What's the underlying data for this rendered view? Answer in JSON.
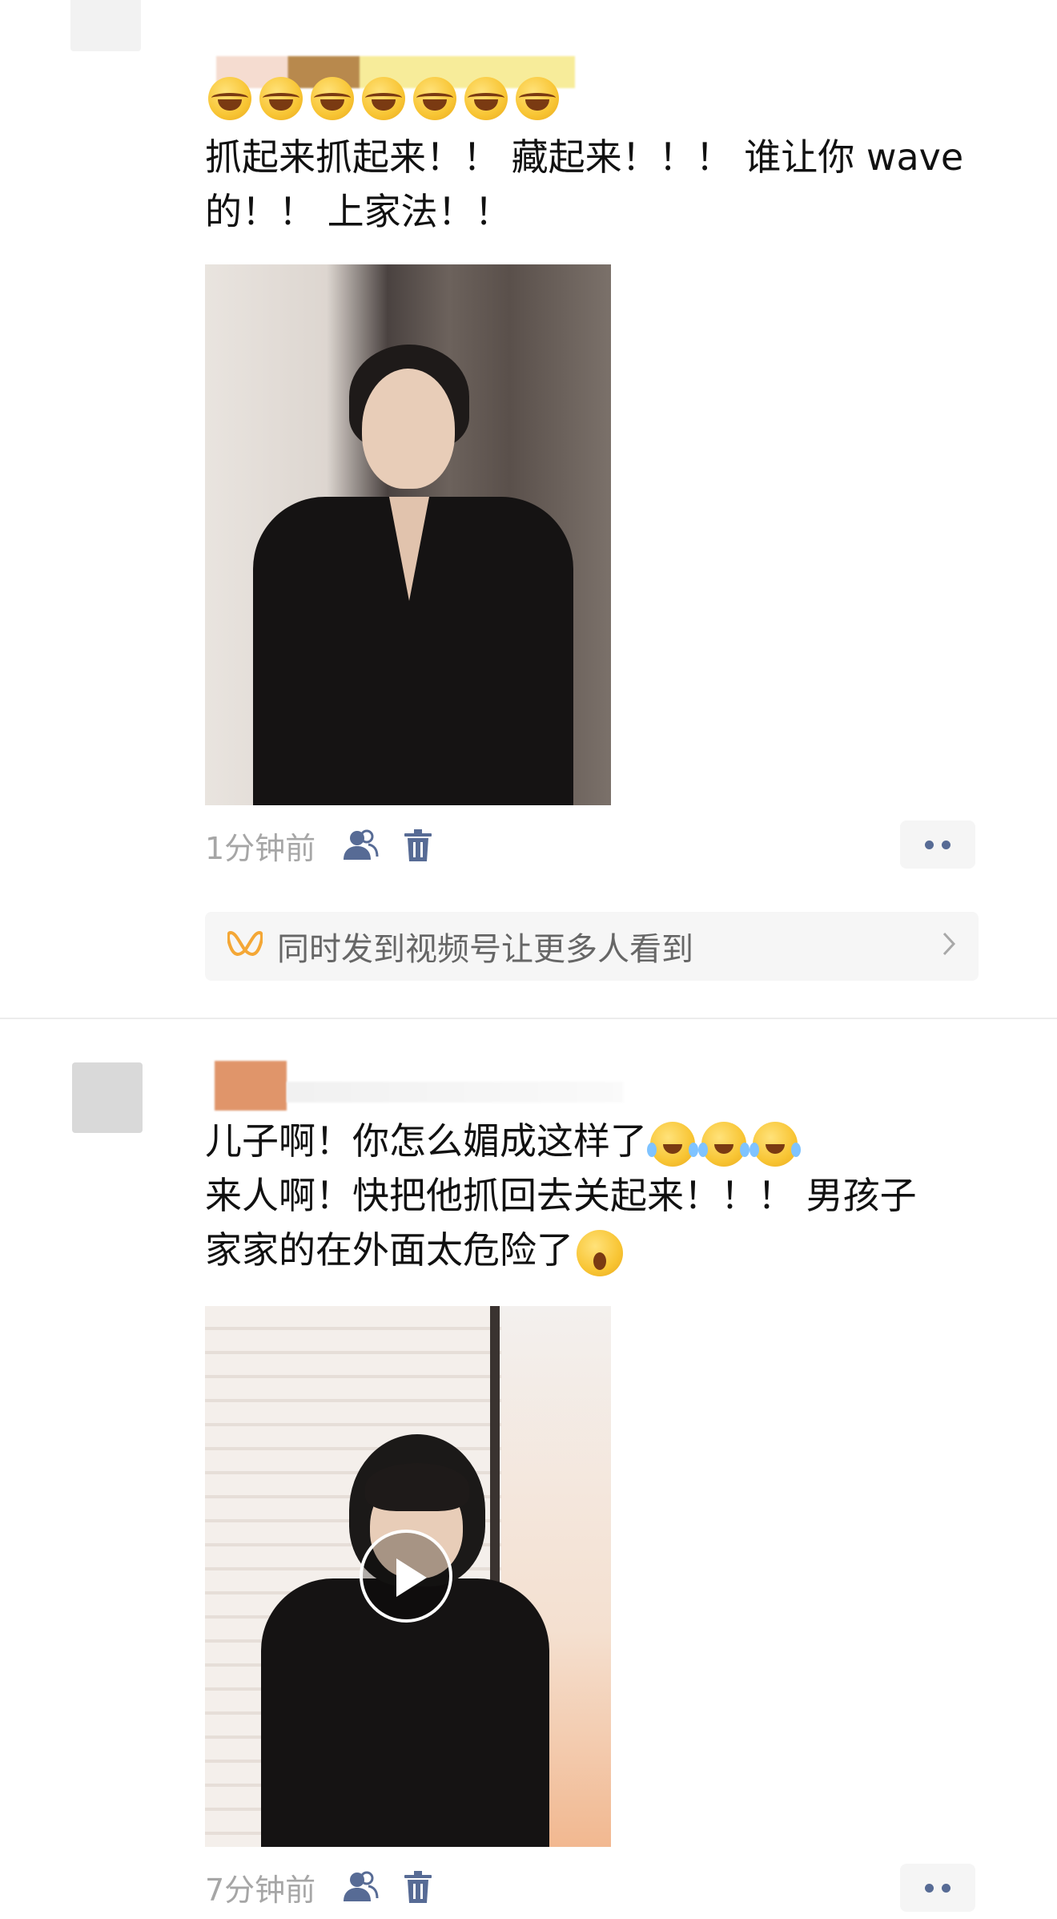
{
  "posts": [
    {
      "text_lines": [
        "抓起来抓起来！！ 藏起来！！！ 谁让你 wave",
        "的！！ 上家法！！"
      ],
      "emoji_row": [
        "laugh-emoji",
        "laugh-emoji",
        "laugh-emoji",
        "laugh-emoji",
        "laugh-emoji",
        "laugh-emoji",
        "laugh-emoji"
      ],
      "media": {
        "kind": "photo",
        "has_play_button": false
      },
      "timestamp": "1分钟前",
      "icons": [
        "visibility-icon",
        "delete-icon"
      ],
      "channels_promo": {
        "label": "同时发到视频号让更多人看到",
        "icon": "channels-icon",
        "chevron": "chevron-right-icon"
      }
    },
    {
      "text_lines": [
        "儿子啊！你怎么媚成这样了",
        "来人啊！快把他抓回去关起来！！！ 男孩子",
        "家家的在外面太危险了"
      ],
      "emoji": {
        "line1": [
          "cry-laugh-emoji",
          "cry-laugh-emoji",
          "cry-laugh-emoji"
        ],
        "line3": [
          "surprised-emoji"
        ]
      },
      "media": {
        "kind": "video",
        "has_play_button": true
      },
      "timestamp": "7分钟前",
      "icons": [
        "visibility-icon",
        "delete-icon"
      ]
    }
  ],
  "colors": {
    "link_blue": "#576b95",
    "timestamp_gray": "#a6a6a6",
    "channels_orange": "#f4a736",
    "divider": "#ececec"
  }
}
